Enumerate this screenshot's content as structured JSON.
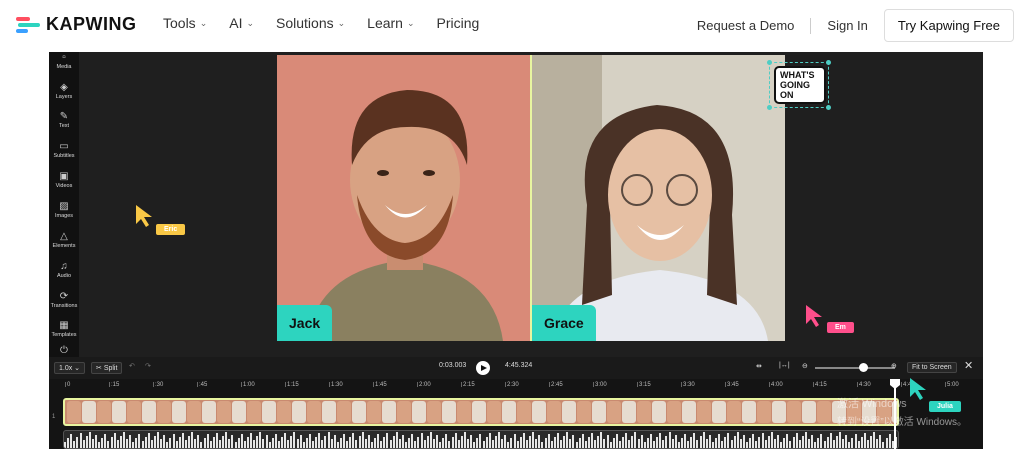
{
  "nav": {
    "logo": "KAPWING",
    "links": [
      {
        "label": "Tools",
        "chev": "⌄"
      },
      {
        "label": "AI",
        "chev": "⌄"
      },
      {
        "label": "Solutions",
        "chev": "⌄"
      },
      {
        "label": "Learn",
        "chev": "⌄"
      },
      {
        "label": "Pricing",
        "chev": ""
      }
    ],
    "demo": "Request a Demo",
    "signin": "Sign In",
    "try": "Try Kapwing Free"
  },
  "toolbar": [
    {
      "label": "Media",
      "icon": "▫"
    },
    {
      "label": "Layers",
      "icon": "◈"
    },
    {
      "label": "Text",
      "icon": "✎"
    },
    {
      "label": "Subtitles",
      "icon": "▭"
    },
    {
      "label": "Videos",
      "icon": "▣"
    },
    {
      "label": "Images",
      "icon": "▨"
    },
    {
      "label": "Elements",
      "icon": "△"
    },
    {
      "label": "Audio",
      "icon": "♫"
    },
    {
      "label": "Transitions",
      "icon": "⟳"
    },
    {
      "label": "Templates",
      "icon": "▦"
    },
    {
      "label": "",
      "icon": "⏻"
    }
  ],
  "canvas": {
    "left_name": "Jack",
    "right_name": "Grace",
    "speech": [
      "WHAT'S",
      "GOING",
      "ON"
    ],
    "cursors": [
      {
        "name": "Eric",
        "color": "#f9c846"
      },
      {
        "name": "Em",
        "color": "#ff4f8b"
      },
      {
        "name": "Julia",
        "color": "#2dd4bf"
      }
    ]
  },
  "timeline": {
    "speed": "1.0x",
    "split": "Split",
    "current": "0:03.003",
    "total": "4:45.324",
    "fit": "Fit to Screen",
    "ticks": [
      "0",
      ":15",
      ":30",
      ":45",
      "1:00",
      "1:15",
      "1:30",
      "1:45",
      "2:00",
      "2:15",
      "2:30",
      "2:45",
      "3:00",
      "3:15",
      "3:30",
      "3:45",
      "4:00",
      "4:15",
      "4:30",
      "4:45",
      "5:00"
    ],
    "track_number": "1"
  },
  "watermark": {
    "line1": "激活 Windows",
    "line2": "转到“设置”以激活 Windows。"
  },
  "colors": {
    "accent": "#2dd4bf",
    "track_border": "#e8f5a0",
    "left_bg": "#d98a78"
  }
}
